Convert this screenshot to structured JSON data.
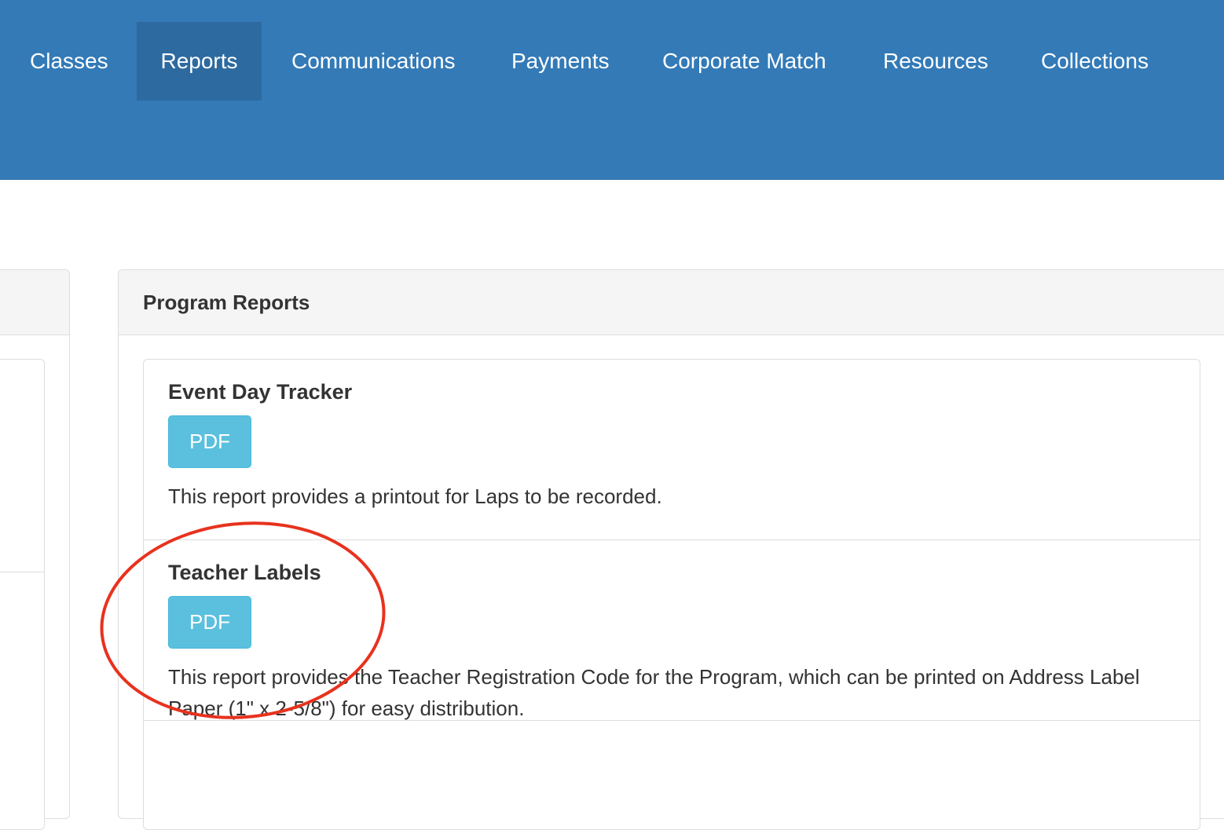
{
  "nav": {
    "items": [
      {
        "label": "Classes",
        "active": false
      },
      {
        "label": "Reports",
        "active": true
      },
      {
        "label": "Communications",
        "active": false
      },
      {
        "label": "Payments",
        "active": false
      },
      {
        "label": "Corporate Match",
        "active": false
      },
      {
        "label": "Resources",
        "active": false
      },
      {
        "label": "Collections",
        "active": false
      }
    ]
  },
  "program_reports": {
    "title": "Program Reports",
    "reports": [
      {
        "title": "Event Day Tracker",
        "button_label": "PDF",
        "description": "This report provides a printout for Laps to be recorded."
      },
      {
        "title": "Teacher Labels",
        "button_label": "PDF",
        "description": "This report provides the Teacher Registration Code for the Program, which can be printed on Address Label Paper (1\" x 2-5/8\") for easy distribution."
      }
    ]
  },
  "colors": {
    "navbar": "#337ab7",
    "nav_active": "#2d6aa0",
    "button_info": "#5bc0de",
    "annotation": "#e8321e"
  }
}
